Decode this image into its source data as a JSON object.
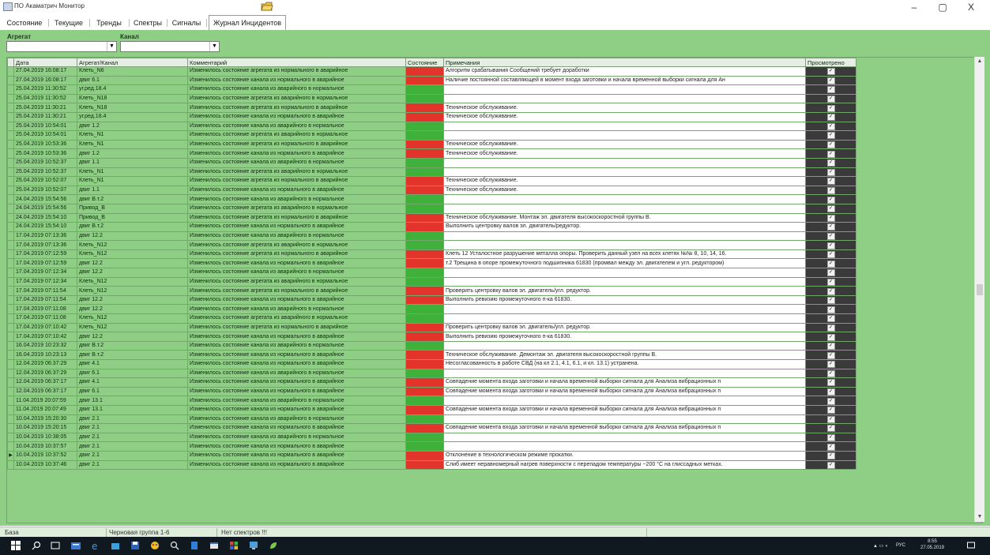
{
  "window": {
    "title": "ПО Акаматрич Монитор",
    "minimize_label": "–",
    "maximize_label": "▢",
    "close_label": "X"
  },
  "tabs": [
    {
      "label": "Состояние"
    },
    {
      "label": "Текущие"
    },
    {
      "label": "Тренды"
    },
    {
      "label": "Спектры"
    },
    {
      "label": "Сигналы"
    },
    {
      "label": "Журнал Инцидентов",
      "active": true
    }
  ],
  "filters": {
    "aggregate_label": "Агрегат",
    "aggregate_value": "",
    "channel_label": "Канал",
    "channel_value": ""
  },
  "table": {
    "columns": [
      "Дата",
      "Агрегат/Канал",
      "Комментарий",
      "Состояние",
      "Примечания",
      "Просмотрено"
    ],
    "rows": [
      {
        "date": "27.04.2019 16:08:17",
        "channel": "Клеть_N6",
        "comment": "Изменилось состояние агрегата из нормального в аварийное",
        "state": "red",
        "note": "Алгоритм срабатывания Сообщений требует доработки",
        "viewed": true
      },
      {
        "date": "27.04.2019 16:08:17",
        "channel": "двиг 6.1",
        "comment": "Изменилось состояние канала из нормального в аварийное",
        "state": "red",
        "note": "Наличие постоянной составляющей в момент входа заготовки и начала временной выборки сигнала для Ан",
        "viewed": true
      },
      {
        "date": "25.04.2019 11:30:52",
        "channel": "уг.ред.18.4",
        "comment": "Изменилось состояние канала из аварийного в нормальное",
        "state": "green",
        "note": "",
        "viewed": true
      },
      {
        "date": "25.04.2019 11:30:52",
        "channel": "Клеть_N18",
        "comment": "Изменилось состояние агрегата из аварийного в нормальное",
        "state": "green",
        "note": "",
        "viewed": true
      },
      {
        "date": "25.04.2019 11:30:21",
        "channel": "Клеть_N18",
        "comment": "Изменилось состояние агрегата из нормального в аварийное",
        "state": "red",
        "note": "Техническое обслуживание.",
        "viewed": true
      },
      {
        "date": "25.04.2019 11:30:21",
        "channel": "уг.ред.18.4",
        "comment": "Изменилось состояние канала из нормального в аварийное",
        "state": "red",
        "note": "Техническое обслуживание.",
        "viewed": true
      },
      {
        "date": "25.04.2019 10:54:01",
        "channel": "двиг 1.2",
        "comment": "Изменилось состояние канала из аварийного в нормальное",
        "state": "green",
        "note": "",
        "viewed": true
      },
      {
        "date": "25.04.2019 10:54:01",
        "channel": "Клеть_N1",
        "comment": "Изменилось состояние агрегата из аварийного в нормальное",
        "state": "green",
        "note": "",
        "viewed": true
      },
      {
        "date": "25.04.2019 10:53:36",
        "channel": "Клеть_N1",
        "comment": "Изменилось состояние агрегата из нормального в аварийное",
        "state": "red",
        "note": "Техническое обслуживание.",
        "viewed": true
      },
      {
        "date": "25.04.2019 10:53:36",
        "channel": "двиг 1.2",
        "comment": "Изменилось состояние канала из нормального в аварийное",
        "state": "red",
        "note": "Техническое обслуживание.",
        "viewed": true
      },
      {
        "date": "25.04.2019 10:52:37",
        "channel": "двиг 1.1",
        "comment": "Изменилось состояние канала из аварийного в нормальное",
        "state": "green",
        "note": "",
        "viewed": true
      },
      {
        "date": "25.04.2019 10:52:37",
        "channel": "Клеть_N1",
        "comment": "Изменилось состояние агрегата из аварийного в нормальное",
        "state": "green",
        "note": "",
        "viewed": true
      },
      {
        "date": "25.04.2019 10:52:07",
        "channel": "Клеть_N1",
        "comment": "Изменилось состояние агрегата из нормального в аварийное",
        "state": "red",
        "note": "Техническое обслуживание.",
        "viewed": true
      },
      {
        "date": "25.04.2019 10:52:07",
        "channel": "двиг 1.1",
        "comment": "Изменилось состояние канала из нормального в аварийное",
        "state": "red",
        "note": "Техническое обслуживание.",
        "viewed": true
      },
      {
        "date": "24.04.2019 15:54:56",
        "channel": "двиг В.т.2",
        "comment": "Изменилось состояние канала из аварийного в нормальное",
        "state": "green",
        "note": "",
        "viewed": true
      },
      {
        "date": "24.04.2019 15:54:56",
        "channel": "Привод_В",
        "comment": "Изменилось состояние агрегата из аварийного в нормальное",
        "state": "green",
        "note": "",
        "viewed": true
      },
      {
        "date": "24.04.2019 15:54:10",
        "channel": "Привод_В",
        "comment": "Изменилось состояние агрегата из нормального в аварийное",
        "state": "red",
        "note": "Техническое обслуживание. Монтаж эл. двигателя высокоскоростной группы В.",
        "viewed": true
      },
      {
        "date": "24.04.2019 15:54:10",
        "channel": "двиг В.т.2",
        "comment": "Изменилось состояние канала из нормального в аварийное",
        "state": "red",
        "note": "Выполнить центровку валов эл. двигатель/редуктор.",
        "viewed": true
      },
      {
        "date": "17.04.2019 07:13:36",
        "channel": "двиг 12.2",
        "comment": "Изменилось состояние канала из аварийного в нормальное",
        "state": "green",
        "note": "",
        "viewed": true
      },
      {
        "date": "17.04.2019 07:13:36",
        "channel": "Клеть_N12",
        "comment": "Изменилось состояние агрегата из аварийного в нормальное",
        "state": "green",
        "note": "",
        "viewed": true
      },
      {
        "date": "17.04.2019 07:12:59",
        "channel": "Клеть_N12",
        "comment": "Изменилось состояние агрегата из нормального в аварийное",
        "state": "red",
        "note": "Клеть 12 Усталостное разрушение металла опоры. Проверить данный узел на всех клетях №№ 8, 10, 14, 16.",
        "viewed": true
      },
      {
        "date": "17.04.2019 07:12:59",
        "channel": "двиг 12.2",
        "comment": "Изменилось состояние канала из нормального в аварийное",
        "state": "red",
        "note": "т.2 Трещина в опоре промежуточного подшипника 61830 (промвал между эл. двигателем и угл. редуктором)",
        "viewed": true
      },
      {
        "date": "17.04.2019 07:12:34",
        "channel": "двиг 12.2",
        "comment": "Изменилось состояние канала из аварийного в нормальное",
        "state": "green",
        "note": "",
        "viewed": true
      },
      {
        "date": "17.04.2019 07:12:34",
        "channel": "Клеть_N12",
        "comment": "Изменилось состояние агрегата из аварийного в нормальное",
        "state": "green",
        "note": "",
        "viewed": true
      },
      {
        "date": "17.04.2019 07:11:54",
        "channel": "Клеть_N12",
        "comment": "Изменилось состояние агрегата из нормального в аварийное",
        "state": "red",
        "note": "Проверить центровку валов эл. двигатель/угл. редуктор.",
        "viewed": true
      },
      {
        "date": "17.04.2019 07:11:54",
        "channel": "двиг 12.2",
        "comment": "Изменилось состояние канала из нормального в аварийное",
        "state": "red",
        "note": "Выполнить ревизию промежуточного п-ка 61830.",
        "viewed": true
      },
      {
        "date": "17.04.2019 07:11:08",
        "channel": "двиг 12.2",
        "comment": "Изменилось состояние канала из аварийного в нормальное",
        "state": "green",
        "note": "",
        "viewed": true
      },
      {
        "date": "17.04.2019 07:11:08",
        "channel": "Клеть_N12",
        "comment": "Изменилось состояние агрегата из аварийного в нормальное",
        "state": "green",
        "note": "",
        "viewed": true
      },
      {
        "date": "17.04.2019 07:10:42",
        "channel": "Клеть_N12",
        "comment": "Изменилось состояние агрегата из нормального в аварийное",
        "state": "red",
        "note": "Проверить центровку валов эл. двигатель/угл. редуктор.",
        "viewed": true
      },
      {
        "date": "17.04.2019 07:10:42",
        "channel": "двиг 12.2",
        "comment": "Изменилось состояние канала из нормального в аварийное",
        "state": "red",
        "note": "Выполнить ревизию промежуточного п-ка 61830.",
        "viewed": true
      },
      {
        "date": "16.04.2019 10:23:32",
        "channel": "двиг В.т.2",
        "comment": "Изменилось состояние канала из аварийного в нормальное",
        "state": "green",
        "note": "",
        "viewed": true
      },
      {
        "date": "16.04.2019 10:23:13",
        "channel": "двиг В.т.2",
        "comment": "Изменилось состояние канала из нормального в аварийное",
        "state": "red",
        "note": "Техническое обслуживание. Демонтаж эл. двигателя высокоскоростной группы В.",
        "viewed": true
      },
      {
        "date": "12.04.2019 06:37:29",
        "channel": "двиг 4.1",
        "comment": "Изменилось состояние канала из нормального в аварийное",
        "state": "red",
        "note": "Несогласованность в работе СВД (на кл 2.1, 4.1, 6.1, и кл. 13.1) устранена.",
        "viewed": true
      },
      {
        "date": "12.04.2019 06:37:29",
        "channel": "двиг 6.1",
        "comment": "Изменилось состояние канала из аварийного в нормальное",
        "state": "green",
        "note": "",
        "viewed": true
      },
      {
        "date": "12.04.2019 06:37:17",
        "channel": "двиг 4.1",
        "comment": "Изменилось состояние канала из нормального в аварийное",
        "state": "red",
        "note": "Совпадение момента входа заготовки и начала временной выборки сигнала для Анализа вибрационных п",
        "viewed": true
      },
      {
        "date": "12.04.2019 06:37:17",
        "channel": "двиг 6.1",
        "comment": "Изменилось состояние канала из нормального в аварийное",
        "state": "red",
        "note": "Совпадение момента входа заготовки и начала временной выборки сигнала для Анализа вибрационных п",
        "viewed": true
      },
      {
        "date": "11.04.2019 20:07:59",
        "channel": "двиг 13.1",
        "comment": "Изменилось состояние канала из аварийного в нормальное",
        "state": "green",
        "note": "",
        "viewed": true
      },
      {
        "date": "11.04.2019 20:07:49",
        "channel": "двиг 13.1",
        "comment": "Изменилось состояние канала из нормального в аварийное",
        "state": "red",
        "note": "Совпадение момента входа заготовки и начала временной выборки сигнала для Анализа вибрационных п",
        "viewed": true
      },
      {
        "date": "10.04.2019 15:20:30",
        "channel": "двиг 2.1",
        "comment": "Изменилось состояние канала из аварийного в нормальное",
        "state": "green",
        "note": "",
        "viewed": true
      },
      {
        "date": "10.04.2019 15:20:15",
        "channel": "двиг 2.1",
        "comment": "Изменилось состояние канала из нормального в аварийное",
        "state": "red",
        "note": "Совпадение момента входа заготовки и начала временной выборки сигнала для Анализа вибрационных п",
        "viewed": true
      },
      {
        "date": "10.04.2019 10:38:05",
        "channel": "двиг 2.1",
        "comment": "Изменилось состояние канала из аварийного в нормальное",
        "state": "green",
        "note": "",
        "viewed": true
      },
      {
        "date": "10.04.2019 10:37:57",
        "channel": "двиг 2.1",
        "comment": "Изменилось состояние канала из нормального в аварийное",
        "state": "green",
        "note": "",
        "viewed": true
      },
      {
        "date": "10.04.2019 10:37:52",
        "channel": "двиг 2.1",
        "comment": "Изменилось состояние канала из нормального в аварийное",
        "state": "red",
        "note": "Отклонение в технологическом режиме прокатки.",
        "viewed": true,
        "current": true
      },
      {
        "date": "10.04.2019 10:37:46",
        "channel": "двиг 2.1",
        "comment": "Изменилось состояние канала из нормального в аварийное",
        "state": "red",
        "note": "Слиб имеет неравномерный нагрев поверхности с перепадом температуры ~200 °С на глиссадных метках.",
        "viewed": true
      }
    ]
  },
  "statusbar": {
    "cell1": "База",
    "cell2": "Черновая группа 1-6",
    "cell3": "Нет спектров !!!"
  },
  "taskbar": {
    "lang": "РУС",
    "time": "8:55",
    "date": "27.05.2019"
  },
  "colors": {
    "alarm": "#e3342b",
    "normal": "#3fb03a",
    "background": "#8fcf85"
  }
}
